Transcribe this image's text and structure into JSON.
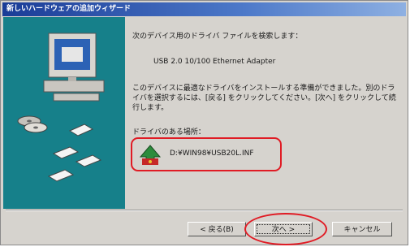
{
  "window": {
    "title": "新しいハードウェアの追加ウィザード"
  },
  "content": {
    "heading": "次のデバイス用のドライバ ファイルを検索します：",
    "device_name": "USB 2.0 10/100 Ethernet Adapter",
    "description": "このデバイスに最適なドライバをインストールする準備ができました。別のドライバを選択するには、[戻る] をクリックしてください。[次へ] をクリックして続行します。",
    "location_label": "ドライバのある場所：",
    "driver_path": "D:¥WIN98¥USB20L.INF"
  },
  "buttons": {
    "back": "< 戻る(B)",
    "next": "次へ >",
    "cancel": "キャンセル"
  },
  "colors": {
    "left_pane": "#16808a",
    "highlight": "#e01b24",
    "titlebar": "#1a3c97"
  },
  "icons": [
    "computer-icon",
    "cd-disc-icon",
    "floppy-disk-icon",
    "hardware-wizard-icon"
  ]
}
